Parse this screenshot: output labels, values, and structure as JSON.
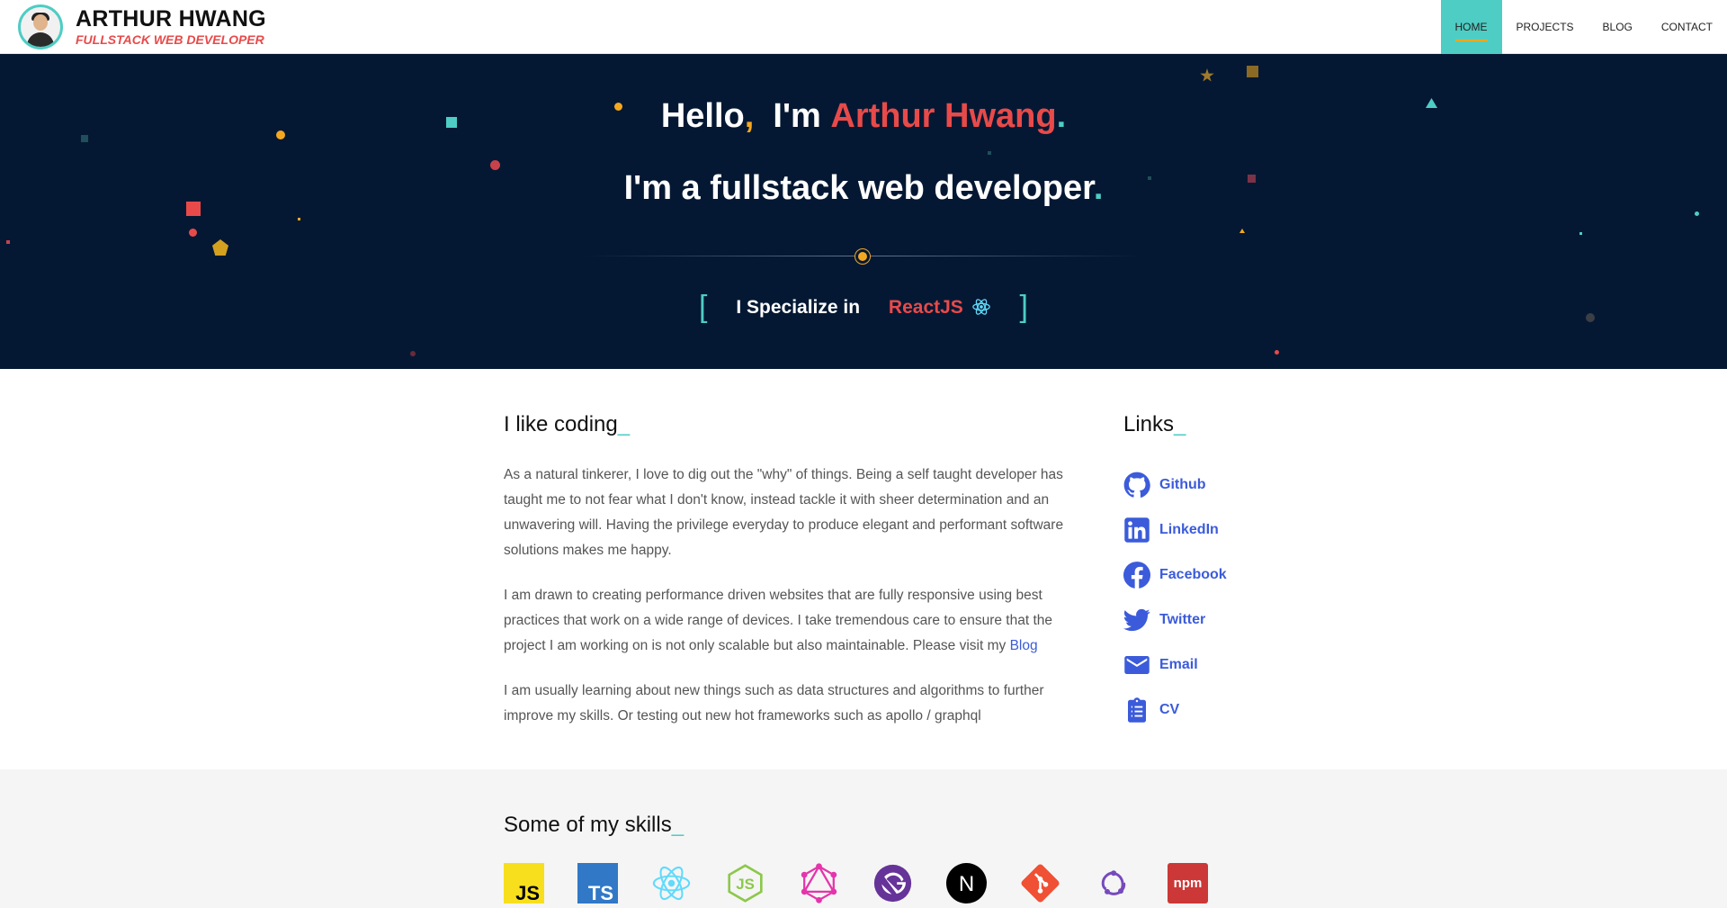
{
  "header": {
    "name": "ARTHUR HWANG",
    "role": "FULLSTACK WEB DEVELOPER",
    "nav": [
      {
        "label": "HOME",
        "active": true
      },
      {
        "label": "PROJECTS",
        "active": false
      },
      {
        "label": "BLOG",
        "active": false
      },
      {
        "label": "CONTACT",
        "active": false
      }
    ]
  },
  "hero": {
    "hello": "Hello",
    "im": "I'm",
    "name": "Arthur Hwang",
    "line2": "I'm a fullstack web developer",
    "bracket_open": "[",
    "bracket_close": "]",
    "specialize": "I Specialize in",
    "tech": "ReactJS"
  },
  "about": {
    "title": "I like coding",
    "paragraphs": [
      "As a natural tinkerer, I love to dig out the \"why\" of things. Being a self taught developer has taught me to not fear what I don't know, instead tackle it with sheer determination and an unwavering will. Having the privilege everyday to produce elegant and performant software solutions makes me happy.",
      "I am drawn to creating performance driven websites that are fully responsive using best practices that work on a wide range of devices. I take tremendous care to ensure that the project I am working on is not only scalable but also maintainable. Please visit my",
      "I am usually learning about new things such as data structures and algorithms to further improve my skills. Or testing out new hot frameworks such as apollo / graphql"
    ],
    "blog_link": "Blog"
  },
  "links": {
    "title": "Links",
    "items": [
      {
        "label": "Github",
        "icon": "github-icon"
      },
      {
        "label": "LinkedIn",
        "icon": "linkedin-icon"
      },
      {
        "label": "Facebook",
        "icon": "facebook-icon"
      },
      {
        "label": "Twitter",
        "icon": "twitter-icon"
      },
      {
        "label": "Email",
        "icon": "email-icon"
      },
      {
        "label": "CV",
        "icon": "clipboard-icon"
      }
    ]
  },
  "skills": {
    "title": "Some of my skills",
    "items": [
      {
        "icon": "javascript-icon",
        "text": "JS"
      },
      {
        "icon": "typescript-icon",
        "text": "TS"
      },
      {
        "icon": "react-icon"
      },
      {
        "icon": "nodejs-icon"
      },
      {
        "icon": "graphql-icon"
      },
      {
        "icon": "gatsby-icon"
      },
      {
        "icon": "nextjs-icon",
        "text": "N"
      },
      {
        "icon": "git-icon"
      },
      {
        "icon": "redux-icon"
      },
      {
        "icon": "npm-icon",
        "text": "npm"
      }
    ]
  },
  "colors": {
    "accent_teal": "#4ecdc4",
    "accent_red": "#e84a4a",
    "accent_orange": "#f4a820",
    "hero_bg": "#051833",
    "link_blue": "#3b5bdb"
  }
}
